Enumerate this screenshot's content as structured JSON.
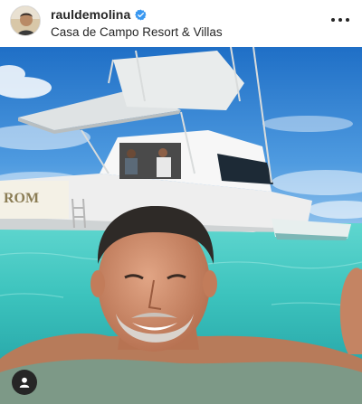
{
  "post": {
    "username": "rauldemolina",
    "location": "Casa de Campo Resort & Villas",
    "verified": true,
    "boat_name": "ROM"
  },
  "icons": {
    "verified": "verified-badge-icon",
    "more": "more-options-icon",
    "tag": "user-tag-icon"
  },
  "colors": {
    "verified_blue": "#3897f0",
    "text": "#262626",
    "sky": "#2e7fd1",
    "water": "#3fc9c4"
  }
}
